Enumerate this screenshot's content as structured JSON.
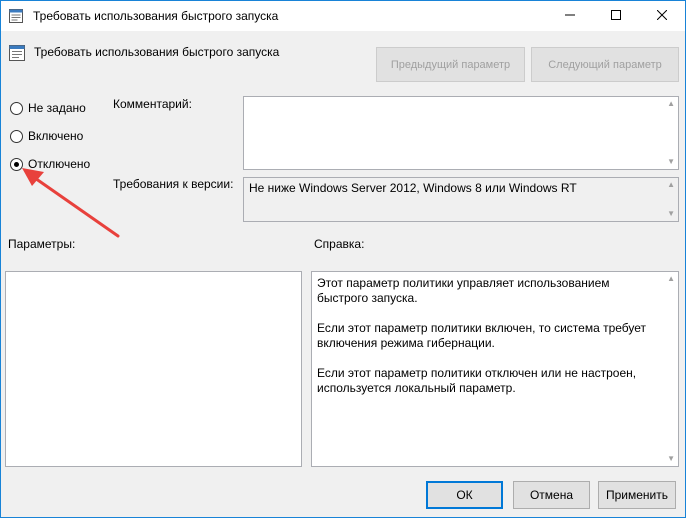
{
  "window": {
    "title": "Требовать использования быстрого запуска",
    "icons": {
      "app": "policy-icon",
      "minimize": "minimize-icon",
      "maximize": "maximize-icon",
      "close": "close-icon"
    }
  },
  "header": {
    "title": "Требовать использования быстрого запуска",
    "prev_label": "Предыдущий параметр",
    "next_label": "Следующий параметр"
  },
  "state": {
    "options": [
      {
        "label": "Не задано",
        "checked": false
      },
      {
        "label": "Включено",
        "checked": false
      },
      {
        "label": "Отключено",
        "checked": true
      }
    ]
  },
  "comment": {
    "label": "Комментарий:",
    "value": ""
  },
  "version": {
    "label": "Требования к версии:",
    "value": "Не ниже Windows Server 2012, Windows 8 или Windows RT"
  },
  "params": {
    "label": "Параметры:"
  },
  "help": {
    "label": "Справка:",
    "paragraphs": [
      "Этот параметр политики управляет использованием быстрого запуска.",
      "Если этот параметр политики включен, то система требует включения режима гибернации.",
      "Если этот параметр политики отключен или не настроен, используется локальный параметр."
    ]
  },
  "buttons": {
    "ok": "ОК",
    "cancel": "Отмена",
    "apply": "Применить"
  },
  "colors": {
    "accent": "#0078d7",
    "annotation_arrow": "#e8413c",
    "border": "#1883d7"
  }
}
